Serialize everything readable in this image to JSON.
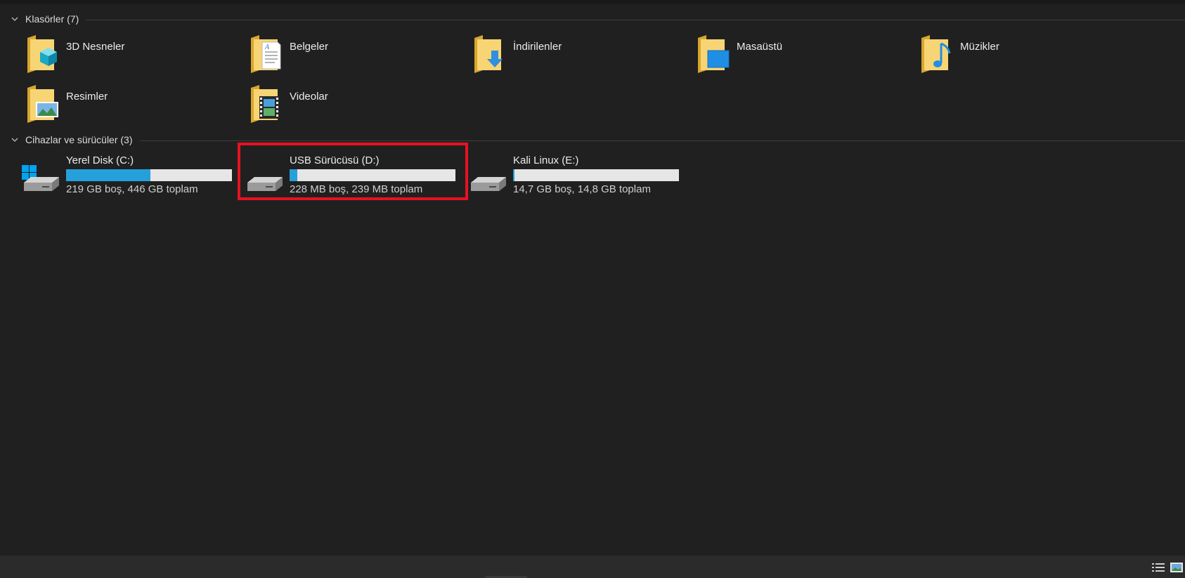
{
  "groups": {
    "folders": {
      "title": "Klasörler (7)"
    },
    "devices": {
      "title": "Cihazlar ve sürücüler (3)"
    }
  },
  "folders": [
    {
      "label": "3D Nesneler",
      "icon": "3d-objects-folder-icon"
    },
    {
      "label": "Belgeler",
      "icon": "documents-folder-icon"
    },
    {
      "label": "İndirilenler",
      "icon": "downloads-folder-icon"
    },
    {
      "label": "Masaüstü",
      "icon": "desktop-folder-icon"
    },
    {
      "label": "Müzikler",
      "icon": "music-folder-icon"
    },
    {
      "label": "Resimler",
      "icon": "pictures-folder-icon"
    },
    {
      "label": "Videolar",
      "icon": "videos-folder-icon"
    }
  ],
  "drives": [
    {
      "name": "Yerel Disk (C:)",
      "info": "219 GB boş, 446 GB toplam",
      "used_fraction": 0.509,
      "icon": "windows-drive-icon",
      "bar_color": "#26a0da"
    },
    {
      "name": "USB Sürücüsü (D:)",
      "info": "228 MB boş, 239 MB toplam",
      "used_fraction": 0.046,
      "icon": "usb-drive-icon",
      "bar_color": "#26a0da"
    },
    {
      "name": "Kali Linux (E:)",
      "info": "14,7 GB boş, 14,8 GB toplam",
      "used_fraction": 0.007,
      "icon": "removable-drive-icon",
      "bar_color": "#26a0da"
    }
  ],
  "highlight": {
    "color": "#e81123",
    "target": "USB Sürücüsü (D:)"
  },
  "statusbar": {
    "view_buttons": [
      {
        "icon": "details-view-icon"
      },
      {
        "icon": "large-icons-view-icon"
      }
    ]
  }
}
